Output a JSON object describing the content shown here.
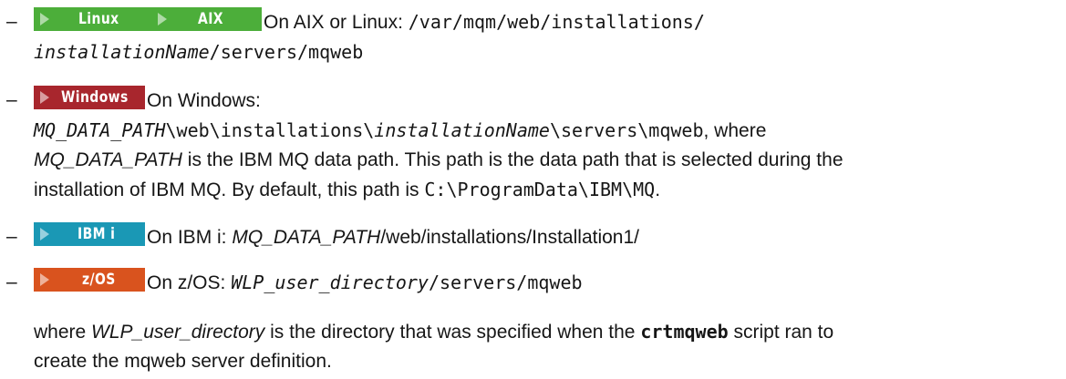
{
  "dash": "–",
  "linux_aix": {
    "badge_linux": "Linux",
    "badge_aix": "AIX",
    "prefix": "On AIX or Linux: ",
    "path_part1": "/var/mqm/web/installations/",
    "path_var": "installationName",
    "path_part2": "/servers/mqweb",
    "badge_color": "#4cae3a"
  },
  "windows": {
    "badge": "Windows",
    "prefix": "On Windows:",
    "path_var1": "MQ_DATA_PATH",
    "path_mid": "\\web\\installations\\",
    "path_var2": "installationName",
    "path_end": "\\servers\\mqweb",
    "suffix": ", where",
    "var_ref": "MQ_DATA_PATH",
    "desc1": " is the IBM MQ data path. This path is the data path that is selected during the",
    "desc2": "installation of IBM MQ. By default, this path is ",
    "default_path": "C:\\ProgramData\\IBM\\MQ",
    "period": ".",
    "badge_color": "#a8262d"
  },
  "ibmi": {
    "badge": "IBM i",
    "prefix": "On IBM i: ",
    "path_var": "MQ_DATA_PATH",
    "path_rest": "/web/installations/Installation1/",
    "badge_color": "#1a98b5"
  },
  "zos": {
    "badge": "z/OS",
    "prefix": "On z/OS: ",
    "path_var": "WLP_user_directory",
    "path_rest": "/servers/mqweb",
    "badge_color": "#d9531e"
  },
  "note": {
    "prefix": "where ",
    "var": "WLP_user_directory",
    "mid": " is the directory that was specified when the ",
    "cmd": "crtmqweb",
    "end1": " script ran to",
    "line2": "create the mqweb server definition."
  }
}
